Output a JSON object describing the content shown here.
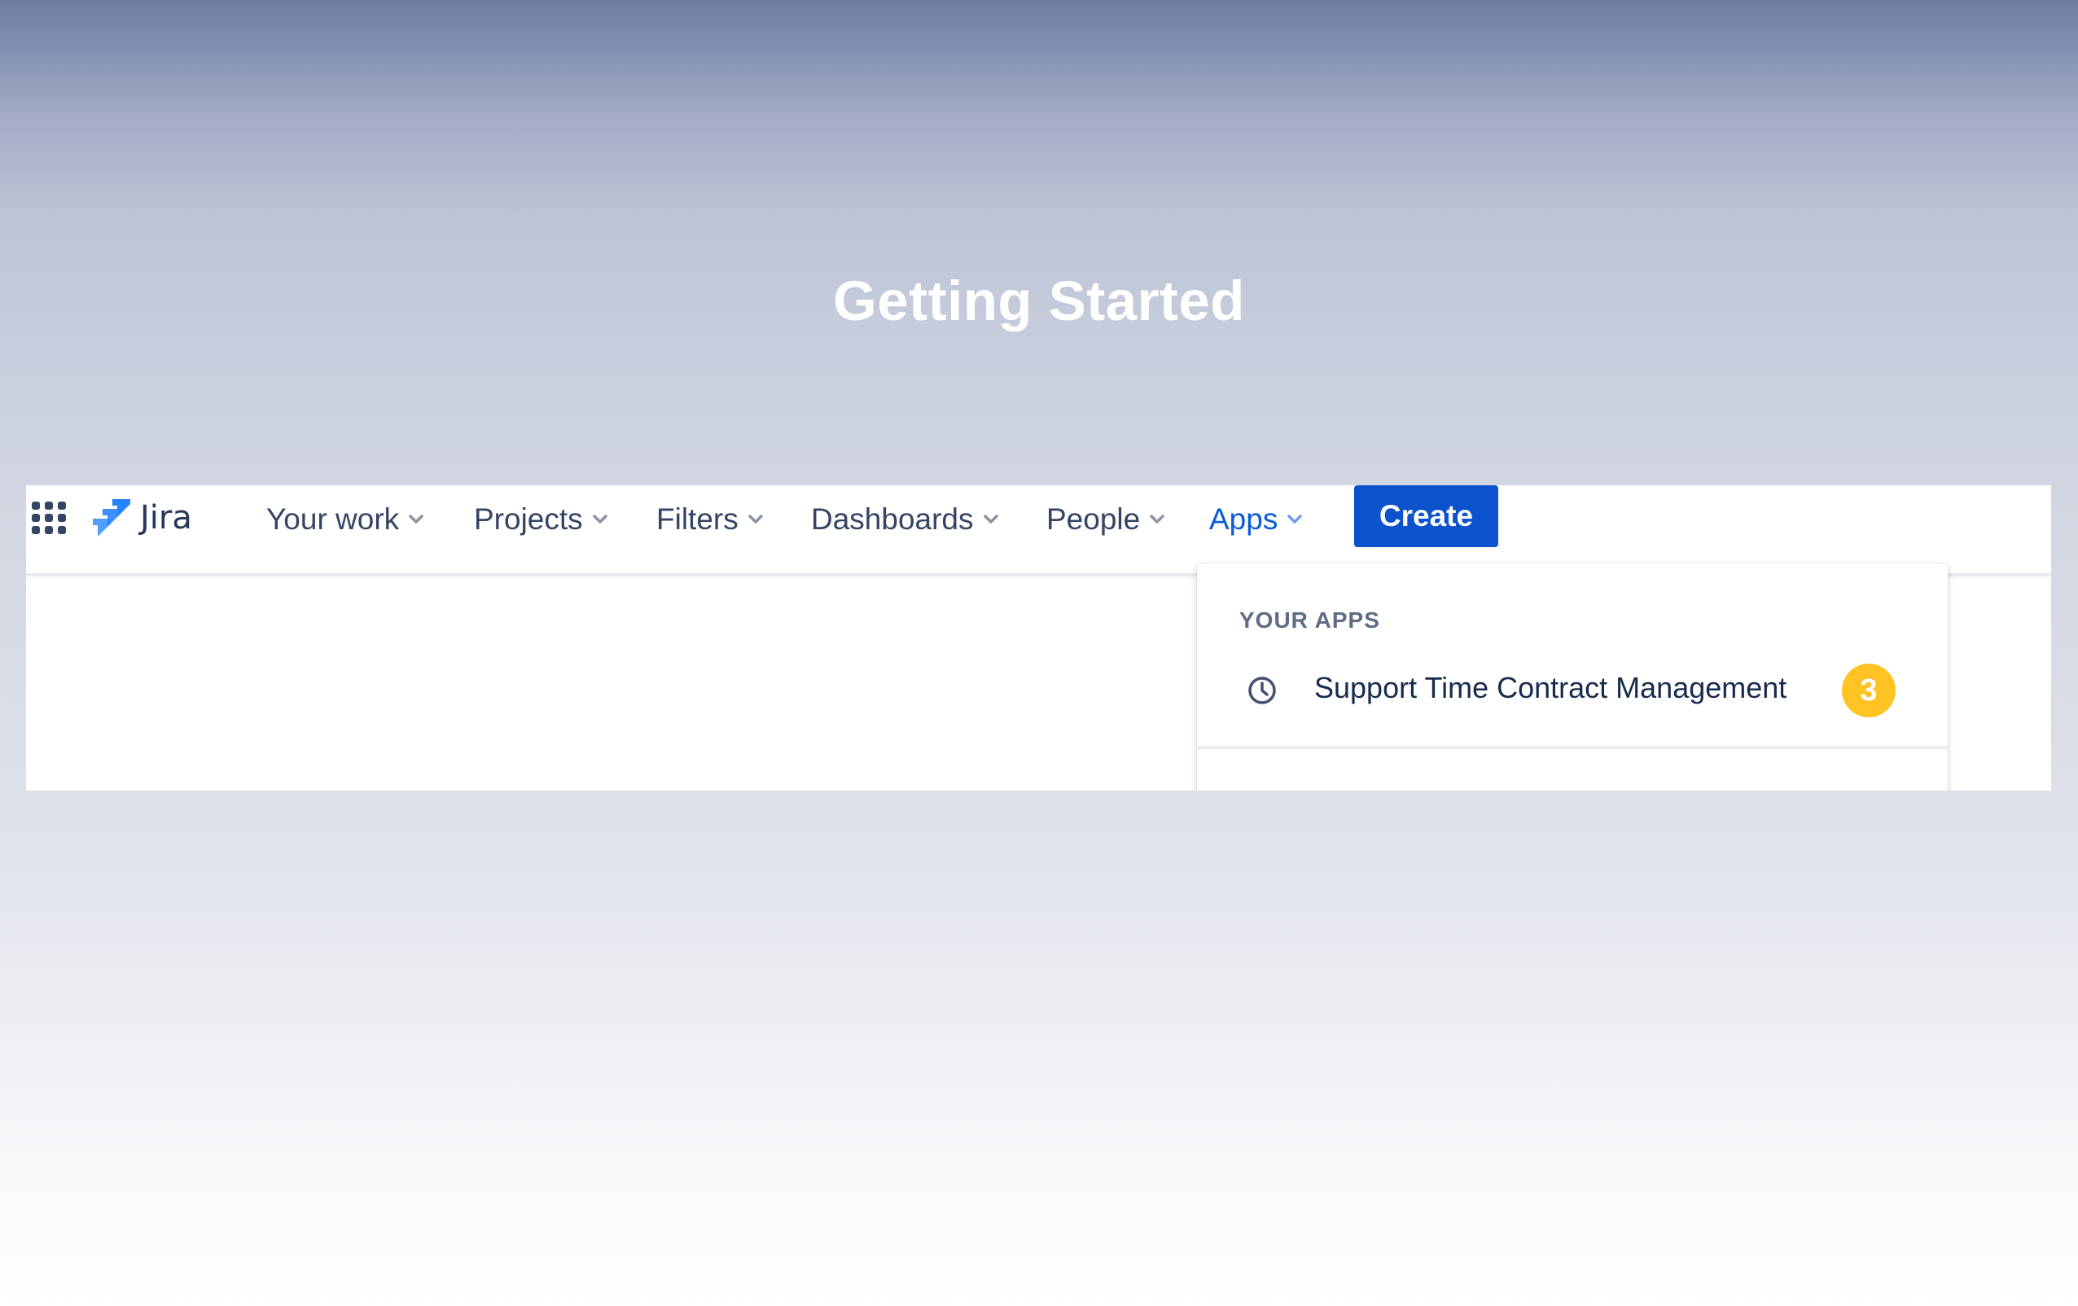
{
  "page": {
    "title": "Getting Started"
  },
  "logo": {
    "text": "Jira",
    "icon": "jira-logo-icon"
  },
  "app_switcher": {
    "icon": "app-grid-icon"
  },
  "nav": {
    "items": [
      {
        "label": "Your work",
        "icon": "chevron-down-icon"
      },
      {
        "label": "Projects",
        "icon": "chevron-down-icon"
      },
      {
        "label": "Filters",
        "icon": "chevron-down-icon"
      },
      {
        "label": "Dashboards",
        "icon": "chevron-down-icon"
      },
      {
        "label": "People",
        "icon": "chevron-down-icon"
      },
      {
        "label": "Apps",
        "icon": "chevron-down-icon",
        "active": true
      }
    ],
    "create_label": "Create"
  },
  "apps_dropdown": {
    "heading": "YOUR APPS",
    "items": [
      {
        "label": "Support Time Contract Management",
        "icon": "clock-icon",
        "badge": "3"
      }
    ]
  },
  "colors": {
    "primary": "#0b52cc",
    "active_nav": "#0a5bd7",
    "nav_text": "#344563",
    "badge": "#ffc423",
    "jira_blue": "#2684ff"
  }
}
